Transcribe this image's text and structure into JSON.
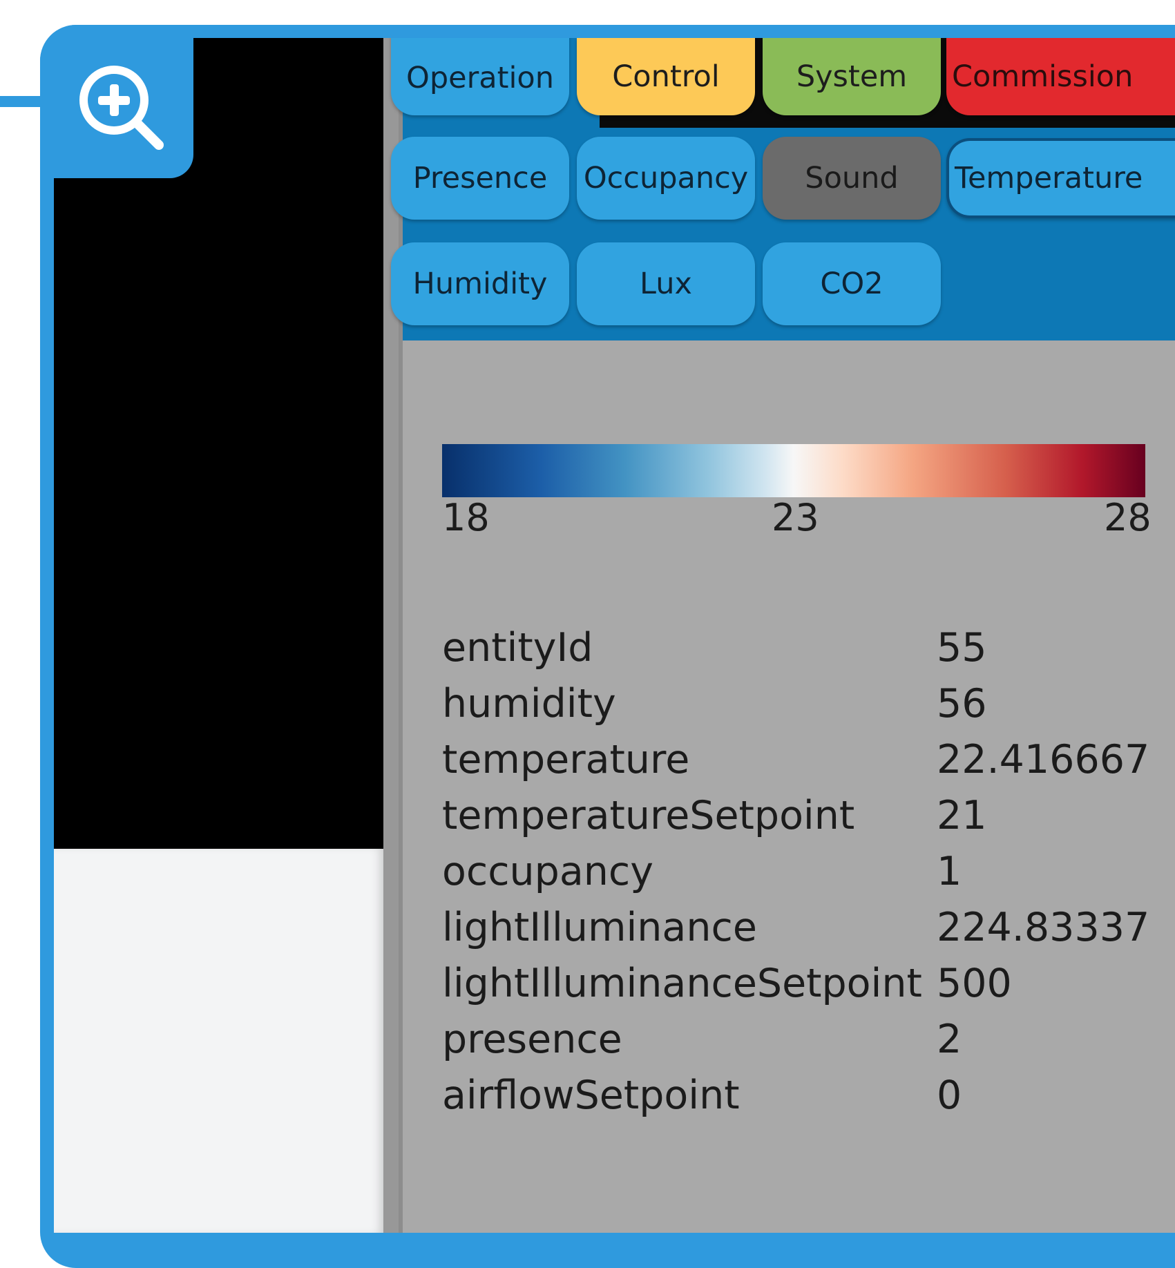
{
  "toolbar": {
    "row1": [
      {
        "label": "Operation",
        "color": "#31a3e0",
        "text_color": "#0e2435"
      },
      {
        "label": "Control",
        "color": "#fdc957",
        "text_color": "#1d1d1d"
      },
      {
        "label": "System",
        "color": "#8abb57",
        "text_color": "#1d1d1d"
      },
      {
        "label": "Commission",
        "color": "#e2292e",
        "text_color": "#2a0d0d"
      }
    ],
    "row2": [
      {
        "label": "Presence",
        "color": "#31a3e0"
      },
      {
        "label": "Occupancy",
        "color": "#31a3e0"
      },
      {
        "label": "Sound",
        "color": "#6b6b6b"
      },
      {
        "label": "Temperature",
        "color": "#31a3e0",
        "selected": true
      }
    ],
    "row3": [
      {
        "label": "Humidity",
        "color": "#31a3e0"
      },
      {
        "label": "Lux",
        "color": "#31a3e0"
      },
      {
        "label": "CO2",
        "color": "#31a3e0"
      }
    ]
  },
  "legend": {
    "min": "18",
    "mid": "23",
    "max": "28"
  },
  "properties": [
    {
      "key": "entityId",
      "value": "55"
    },
    {
      "key": "humidity",
      "value": "56"
    },
    {
      "key": "temperature",
      "value": "22.416667"
    },
    {
      "key": "temperatureSetpoint",
      "value": "21"
    },
    {
      "key": "occupancy",
      "value": "1"
    },
    {
      "key": "lightIlluminance",
      "value": "224.83337"
    },
    {
      "key": "lightIlluminanceSetpoint",
      "value": "500"
    },
    {
      "key": "presence",
      "value": "2"
    },
    {
      "key": "airflowSetpoint",
      "value": "0"
    }
  ],
  "icons": {
    "zoom": "zoom-in-icon"
  },
  "colors": {
    "frame": "#2f9ade",
    "toolbar_bg": "#0d78b5",
    "panel_bg": "#a9a9a9"
  }
}
